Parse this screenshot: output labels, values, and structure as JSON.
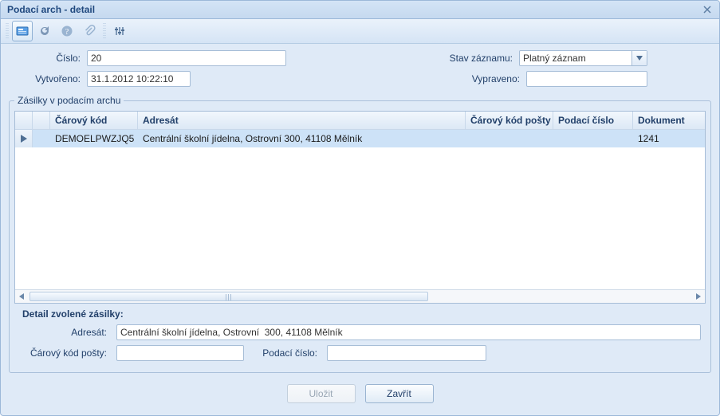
{
  "window": {
    "title": "Podací arch - detail"
  },
  "form": {
    "cislo_label": "Číslo:",
    "cislo_value": "20",
    "vytvoreno_label": "Vytvořeno:",
    "vytvoreno_value": "31.1.2012 10:22:10",
    "stav_label": "Stav záznamu:",
    "stav_value": "Platný záznam",
    "vypraveno_label": "Vypraveno:",
    "vypraveno_value": ""
  },
  "grid": {
    "legend": "Zásilky v podacím archu",
    "headers": {
      "barcode": "Čárový kód",
      "adresat": "Adresát",
      "barcode_post": "Čárový kód pošty",
      "podaci_cislo": "Podací číslo",
      "dokument": "Dokument"
    },
    "rows": [
      {
        "selected": true,
        "barcode": "DEMOELPWZJQ5",
        "adresat": "Centrální školní jídelna, Ostrovní  300, 41108 Mělník",
        "barcode_post": "",
        "podaci_cislo": "",
        "dokument": "1241"
      }
    ]
  },
  "detail": {
    "heading": "Detail zvolené zásilky:",
    "adresat_label": "Adresát:",
    "adresat_value": "Centrální školní jídelna, Ostrovní  300, 41108 Mělník",
    "barcode_post_label": "Čárový kód pošty:",
    "barcode_post_value": "",
    "podaci_cislo_label": "Podací číslo:",
    "podaci_cislo_value": ""
  },
  "buttons": {
    "save": "Uložit",
    "close": "Zavřít"
  }
}
